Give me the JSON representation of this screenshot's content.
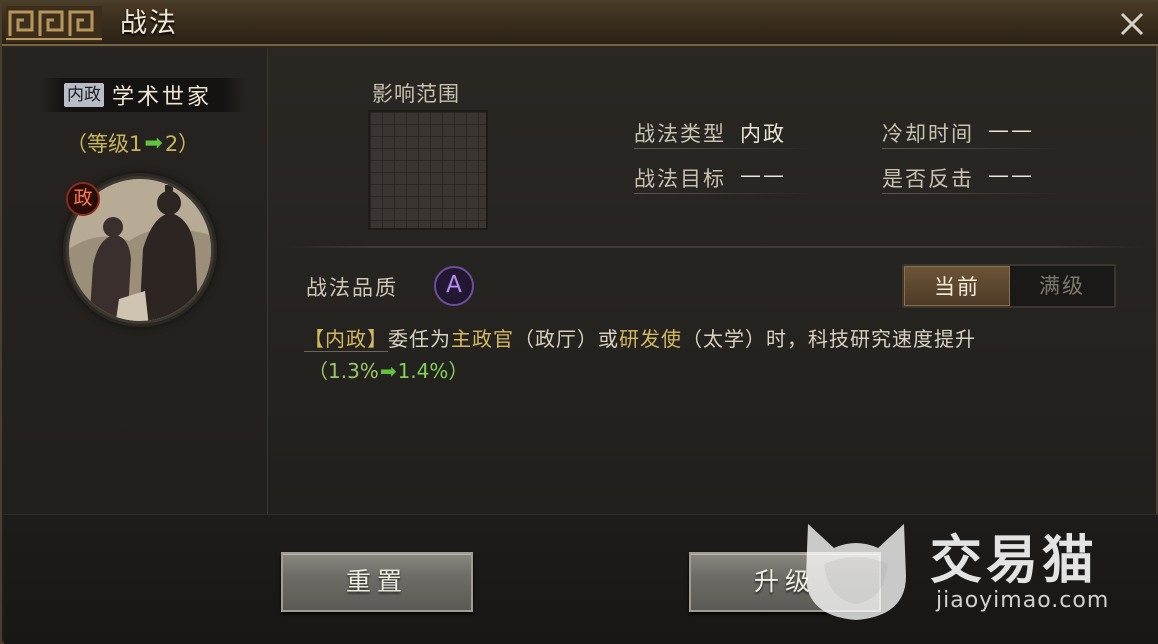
{
  "window": {
    "title": "战法",
    "close_icon": "close-icon"
  },
  "skill": {
    "type_tag": "内政",
    "name": "学术世家",
    "level_prefix": "（等级1",
    "level_arrow": "➡",
    "level_suffix": "2）",
    "portrait_badge": "政"
  },
  "details": {
    "range_label": "影响范围",
    "skill_type_label": "战法类型",
    "skill_type_value": "内政",
    "cooldown_label": "冷却时间",
    "cooldown_value": "——",
    "target_label": "战法目标",
    "target_value": "——",
    "counter_label": "是否反击",
    "counter_value": "——"
  },
  "quality": {
    "label": "战法品质",
    "grade": "A"
  },
  "toggle": {
    "current": "当前",
    "max_level": "满级",
    "selected": "current"
  },
  "description": {
    "tag": "【内政】",
    "p1": "委任为",
    "role1": "主政官",
    "p2": "（政厅）或",
    "role2": "研发使",
    "p3": "（太学）时，科技研究速度提升",
    "open": "（1.3%",
    "arrow": "➡",
    "close": "1.4%）"
  },
  "buttons": {
    "reset": "重置",
    "upgrade": "升级"
  },
  "watermark": {
    "name": "交易猫",
    "url": "jiaoyimao.com"
  },
  "colors": {
    "gold_text": "#d2b85e",
    "green_arrow": "#62c43a",
    "quality_purple": "#b58ff0"
  }
}
